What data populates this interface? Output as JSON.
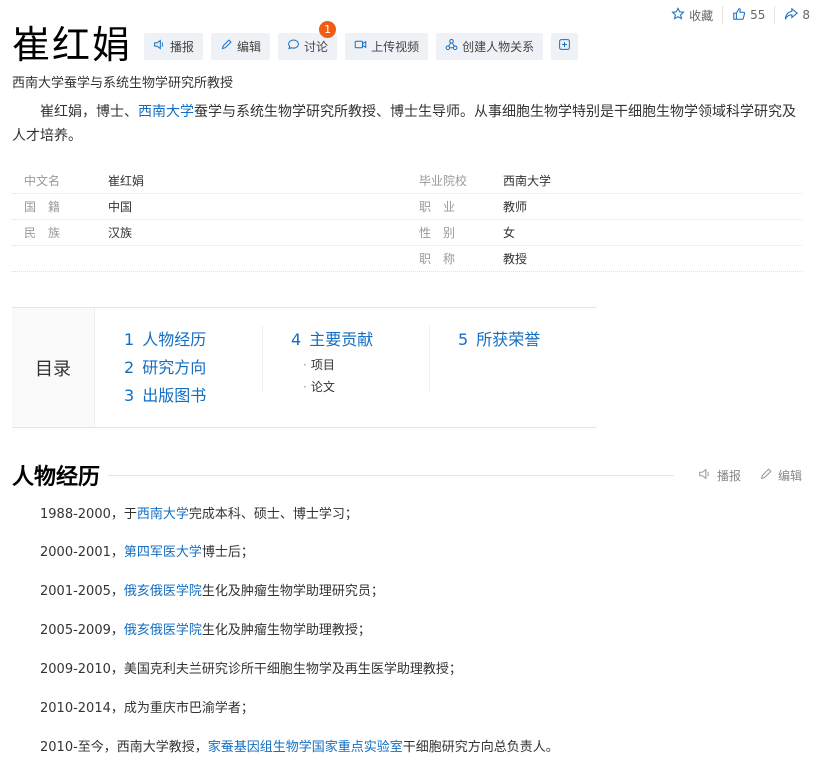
{
  "topbar": {
    "favorite_label": "收藏",
    "like_count": "55",
    "share_count": "8"
  },
  "header": {
    "title": "崔红娟",
    "tools": [
      {
        "label": "播报"
      },
      {
        "label": "编辑"
      },
      {
        "label": "讨论",
        "badge": "1"
      },
      {
        "label": "上传视频"
      },
      {
        "label": "创建人物关系"
      }
    ],
    "subtitle": "西南大学蚕学与系统生物学研究所教授"
  },
  "summary": {
    "part1": "崔红娟，博士、",
    "link1": "西南大学",
    "part2": "蚕学与系统生物学研究所教授、博士生导师。从事细胞生物学特别是干细胞生物学领域科学研究及人才培养。"
  },
  "infobox": {
    "rows": [
      {
        "left_name": "中文名",
        "left_value": "崔红娟",
        "right_name": "毕业院校",
        "right_value": "西南大学"
      },
      {
        "left_name": "国　籍",
        "left_value": "中国",
        "right_name": "职　业",
        "right_value": "教师"
      },
      {
        "left_name": "民　族",
        "left_value": "汉族",
        "right_name": "性　别",
        "right_value": "女"
      },
      {
        "left_name": "",
        "left_value": "",
        "right_name": "职　称",
        "right_value": "教授"
      }
    ]
  },
  "catalog": {
    "title": "目录",
    "items": [
      {
        "num": "1",
        "label": "人物经历"
      },
      {
        "num": "2",
        "label": "研究方向"
      },
      {
        "num": "3",
        "label": "出版图书"
      },
      {
        "num": "4",
        "label": "主要贡献"
      },
      {
        "num": "5",
        "label": "所获荣誉"
      }
    ],
    "subitems": [
      "项目",
      "论文"
    ]
  },
  "section": {
    "title": "人物经历",
    "broadcast_label": "播报",
    "edit_label": "编辑",
    "paragraphs": [
      {
        "pre": "1988-2000，于",
        "link": "西南大学",
        "post": "完成本科、硕士、博士学习；"
      },
      {
        "pre": "2000-2001，",
        "link": "第四军医大学",
        "post": "博士后；"
      },
      {
        "pre": "2001-2005，",
        "link": "俄亥俄医学院",
        "post": "生化及肿瘤生物学助理研究员；"
      },
      {
        "pre": "2005-2009，",
        "link": "俄亥俄医学院",
        "post": "生化及肿瘤生物学助理教授；"
      },
      {
        "pre": "2009-2010，美国克利夫兰研究诊所干细胞生物学及再生医学助理教授；",
        "link": "",
        "post": ""
      },
      {
        "pre": "2010-2014，成为重庆市巴渝学者；",
        "link": "",
        "post": ""
      },
      {
        "pre": "2010-至今，西南大学教授，",
        "link": "家蚕基因组生物学国家重点实验室",
        "post": "干细胞研究方向总负责人。"
      }
    ]
  },
  "colors": {
    "link": "#136ec2",
    "badge": "#f25c12",
    "tool_bg": "#eef1f5"
  }
}
